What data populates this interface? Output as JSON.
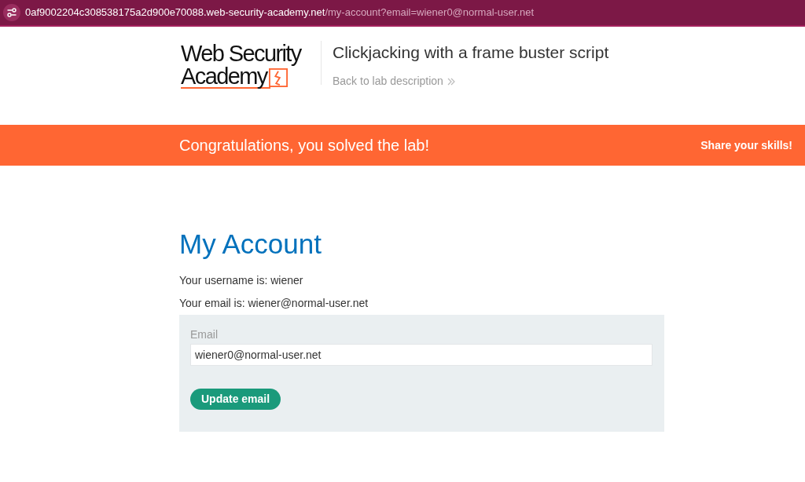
{
  "address_bar": {
    "host": "0af9002204c308538175a2d900e70088.web-security-academy.net",
    "path": "/my-account?email=wiener0@normal-user.net"
  },
  "header": {
    "logo": {
      "line_1": "Web Security",
      "line_2": "Academy"
    },
    "title": "Clickjacking with a frame buster script",
    "back_link": "Back to lab description"
  },
  "banner": {
    "message": "Congratulations, you solved the lab!",
    "share": "Share your skills!"
  },
  "account": {
    "heading": "My Account",
    "username_line": "Your username is: wiener",
    "email_line": "Your email is: wiener@normal-user.net",
    "form": {
      "label": "Email",
      "value": "wiener0@normal-user.net",
      "button": "Update email"
    }
  }
}
